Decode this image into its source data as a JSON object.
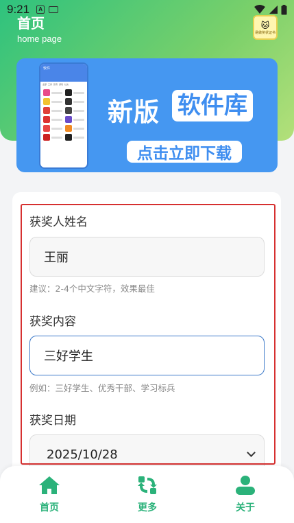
{
  "status_bar": {
    "time": "9:21",
    "a_icon": "A"
  },
  "header": {
    "title": "首页",
    "subtitle": "home page",
    "logo_face": "🐱",
    "logo_text": "易做奖状证书"
  },
  "banner": {
    "phone_title": "软件",
    "phone_tabs": [
      "全部",
      "工具",
      "影音",
      "游戏",
      "社交"
    ],
    "title_left": "新版",
    "title_right": "软件库",
    "button_label": "点击立即下载"
  },
  "form": {
    "name_label": "获奖人姓名",
    "name_value": "王丽",
    "name_hint": "建议：2-4个中文字符，效果最佳",
    "content_label": "获奖内容",
    "content_value": "三好学生",
    "content_hint": "例如：三好学生、优秀干部、学习标兵",
    "date_label": "获奖日期",
    "date_value": "2025/10/28"
  },
  "bottom_nav": {
    "items": [
      {
        "label": "首页",
        "icon": "home-icon"
      },
      {
        "label": "更多",
        "icon": "refresh-icon"
      },
      {
        "label": "关于",
        "icon": "user-icon"
      }
    ]
  },
  "colors": {
    "accent_green": "#2bb27a",
    "banner_blue": "#4597f1",
    "highlight_red": "#d63030",
    "focus_blue": "#3a78c8"
  }
}
